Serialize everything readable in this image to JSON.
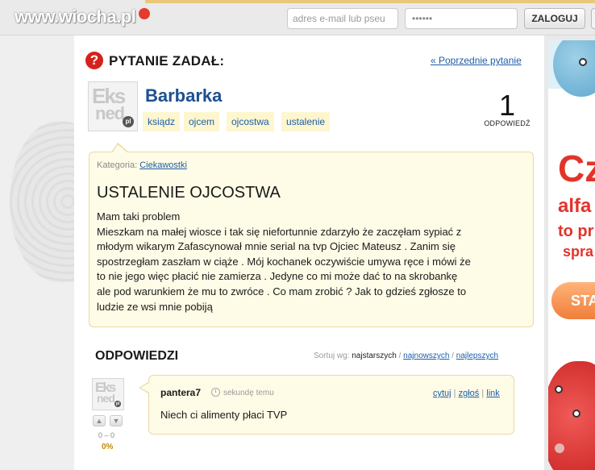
{
  "header": {
    "logo_text": "www.wiocha.pl",
    "email_placeholder": "adres e-mail lub pseu",
    "password_value": "••••••",
    "login_label": "ZALOGUJ"
  },
  "question": {
    "heading": "PYTANIE ZADAŁ:",
    "prev_link": "« Poprzednie pytanie",
    "author": "Barbarka",
    "tags": [
      "ksiądz",
      "ojcem",
      "ojcostwa",
      "ustalenie"
    ],
    "answer_count": "1",
    "answer_count_label": "ODPOWIEDŹ",
    "category_label": "Kategoria:",
    "category": "Ciekawostki",
    "title": "USTALENIE OJCOSTWA",
    "body_lines": [
      "Mam taki problem",
      "Mieszkam na małej wiosce i tak się niefortunnie zdarzyło że zaczęłam sypiać z",
      "młodym wikarym Zafascynował mnie serial na tvp Ojciec Mateusz . Zanim się",
      "spostrzegłam zaszłam w ciąże . Mój kochanek oczywiście umywa ręce i mówi że",
      "to nie jego więc płacić nie zamierza . Jedyne co mi może dać to na skrobankę",
      "ale pod warunkiem że mu to zwróce . Co mam zrobić ? Jak to gdzieś zgłosze to",
      "ludzie ze wsi mnie pobiją"
    ]
  },
  "answers": {
    "heading": "ODPOWIEDZI",
    "sort_label": "Sortuj wg:",
    "sort_active": "najstarszych",
    "sort_options": [
      "najnowszych",
      "najlepszych"
    ],
    "items": [
      {
        "user": "pantera7",
        "time": "sekundę temu",
        "actions": [
          "cytuj",
          "zgłoś",
          "link"
        ],
        "text": "Niech ci alimenty płaci TVP",
        "votes": "0 – 0",
        "percent": "0%"
      }
    ]
  },
  "avatar_text": {
    "line1": "Eks",
    "line2": "ned",
    "badge": "pl"
  },
  "ad": {
    "big": "Cz",
    "line1": "alfa",
    "line2": "to pr",
    "line3": "spra",
    "cta": "STA"
  },
  "colors": {
    "accent_link": "#1d5ea8",
    "question_icon": "#d4231c",
    "box_bg": "#fefbe6"
  }
}
